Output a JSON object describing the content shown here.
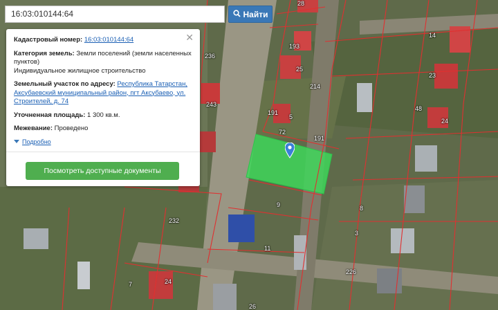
{
  "search": {
    "value": "16:03:010144:64",
    "button_label": "Найти",
    "icon": "search-icon"
  },
  "info": {
    "cadastral_label": "Кадастровый номер:",
    "cadastral_value": "16:03:010144:64",
    "category_label": "Категория земель:",
    "category_value": "Земли поселений (земли населенных пунктов)",
    "usage_value": "Индивидуальное жилищное строительство",
    "address_label": "Земельный участок по адресу:",
    "address_value": "Республика Татарстан, Аксубаевский муниципальный район, пгт Аксубаево, ул. Строителей, д. 74",
    "area_label": "Уточненная площадь:",
    "area_value": "1 300 кв.м.",
    "survey_label": "Межевание:",
    "survey_value": "Проведено",
    "more_label": "Подробно",
    "docs_button": "Посмотреть доступные документы",
    "close_icon": "close-icon"
  },
  "map": {
    "plot_labels": [
      "28",
      "14",
      "193",
      "25",
      "23",
      "236",
      "214",
      "48",
      "243",
      "191",
      "5",
      "24",
      "191",
      "72",
      "9",
      "8",
      "232",
      "11",
      "3",
      "226",
      "7",
      "24",
      "26"
    ]
  },
  "colors": {
    "selected_plot": "#3ddb5a",
    "boundary": "#e03030",
    "button_blue": "#3a78b7",
    "button_green": "#4fae4f"
  }
}
